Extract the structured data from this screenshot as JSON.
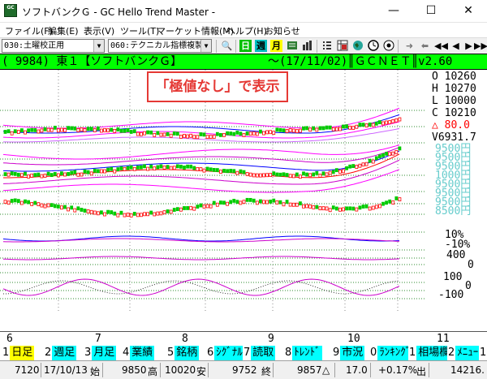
{
  "window": {
    "icon_text": "GC",
    "title": "ソフトバンクＧ - GC Hello Trend Master -",
    "minimize": "—",
    "maximize": "☐",
    "close": "✕"
  },
  "menu": [
    "ファイル(F)",
    "編集(E)",
    "表示(V)",
    "ツール(T)",
    "マーケット情報(M)",
    "ヘルプ(H)",
    "お知らせ"
  ],
  "toolbar": {
    "combo1": "030:土曜校正用",
    "combo2": "060:テクニカル指標複製済",
    "btn_day": "日",
    "btn_week": "週",
    "btn_month": "月"
  },
  "stock_header": {
    "left": "( 9984) 東１【ソフトバンクＧ】",
    "right": "～(17/11/02)║ＧＣＮＥＴ║v2.60"
  },
  "callout": "「極値なし」で表示",
  "ohlc": {
    "open": "O 10260",
    "high": "H 10270",
    "low": "L 10000",
    "close": "C 10210",
    "change": "△ 80.0",
    "volume": "V6931.7"
  },
  "price_scale": [
    "9500円",
    "9500円",
    "9500円",
    "1000円",
    "9500円",
    "9500円",
    "9500円",
    "8500円"
  ],
  "indicator_labels": [
    "10%",
    "-10%",
    "400",
    "0",
    "100",
    "0",
    "-100"
  ],
  "months": [
    "6",
    "7",
    "8",
    "9",
    "10",
    "11"
  ],
  "function_keys": [
    {
      "num": "1",
      "label": "日足"
    },
    {
      "num": "2",
      "label": "週足"
    },
    {
      "num": "3",
      "label": "月足"
    },
    {
      "num": "4",
      "label": "業績"
    },
    {
      "num": "5",
      "label": "銘柄"
    },
    {
      "num": "6",
      "label": "ｼｸﾞﾅﾙ"
    },
    {
      "num": "7",
      "label": "読取"
    },
    {
      "num": "8",
      "label": "ﾄﾚﾝﾄﾞ"
    },
    {
      "num": "9",
      "label": "市況"
    },
    {
      "num": "0",
      "label": "ﾗﾝｷﾝｸﾞ"
    },
    {
      "num": "1",
      "label": "相場欄"
    },
    {
      "num": "2",
      "label": "ﾒﾆｭｰ"
    },
    {
      "num": "1",
      "label": ""
    }
  ],
  "status": {
    "code": "7120",
    "date": "17/10/13",
    "open_label": "始",
    "open": "9850",
    "high_label": "高",
    "high": "10020",
    "low_label": "安",
    "low": "9752",
    "close_label": "終",
    "close": "9857",
    "change_sign": "△",
    "change": "17.0",
    "pct": "+0.17%",
    "vol_label": "出",
    "volume": "14216."
  },
  "colors": {
    "header_green": "#00ff00",
    "fkey_cyan": "#00ffff",
    "fkey_yellow": "#ffff00",
    "callout_red": "#e53935",
    "candle_red": "#ff0000",
    "candle_green": "#00cc00",
    "band_magenta": "#cc00cc",
    "line_blue": "#0000ff",
    "grid_green": "#2e8b2e",
    "scale_cyan": "#66cccc"
  }
}
